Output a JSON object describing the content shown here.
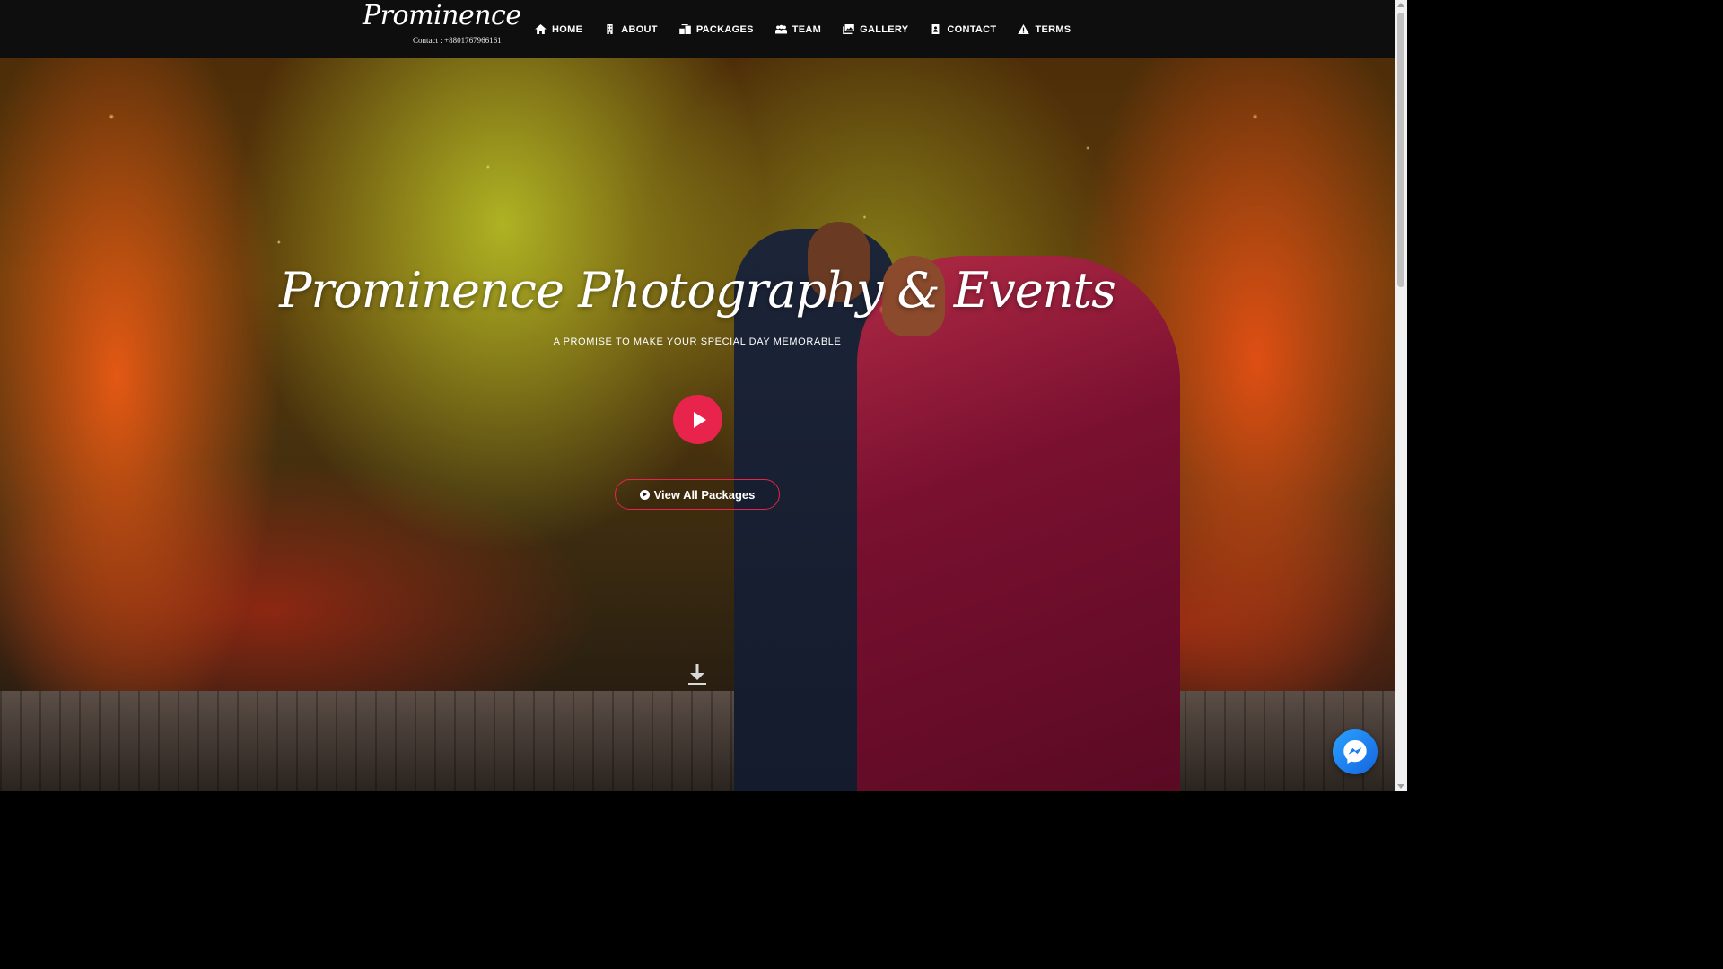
{
  "brand": {
    "logo_text": "Prominence",
    "contact_text": "Contact : +8801767966161"
  },
  "nav": {
    "items": [
      {
        "label": "HOME",
        "icon": "home-icon"
      },
      {
        "label": "ABOUT",
        "icon": "building-icon"
      },
      {
        "label": "PACKAGES",
        "icon": "packages-icon"
      },
      {
        "label": "TEAM",
        "icon": "team-icon"
      },
      {
        "label": "GALLERY",
        "icon": "gallery-icon"
      },
      {
        "label": "CONTACT",
        "icon": "contact-card-icon"
      },
      {
        "label": "TERMS",
        "icon": "warning-icon"
      }
    ]
  },
  "hero": {
    "title": "Prominence Photography & Events",
    "subtitle": "A PROMISE TO MAKE YOUR SPECIAL DAY MEMORABLE",
    "cta_label": "View All Packages",
    "play_icon": "play-icon",
    "scroll_icon": "download-arrow-icon"
  },
  "messenger": {
    "icon": "messenger-icon"
  },
  "colors": {
    "accent": "#e8244d",
    "navbar": "#0e0e0e",
    "messenger": "#1877f2"
  }
}
